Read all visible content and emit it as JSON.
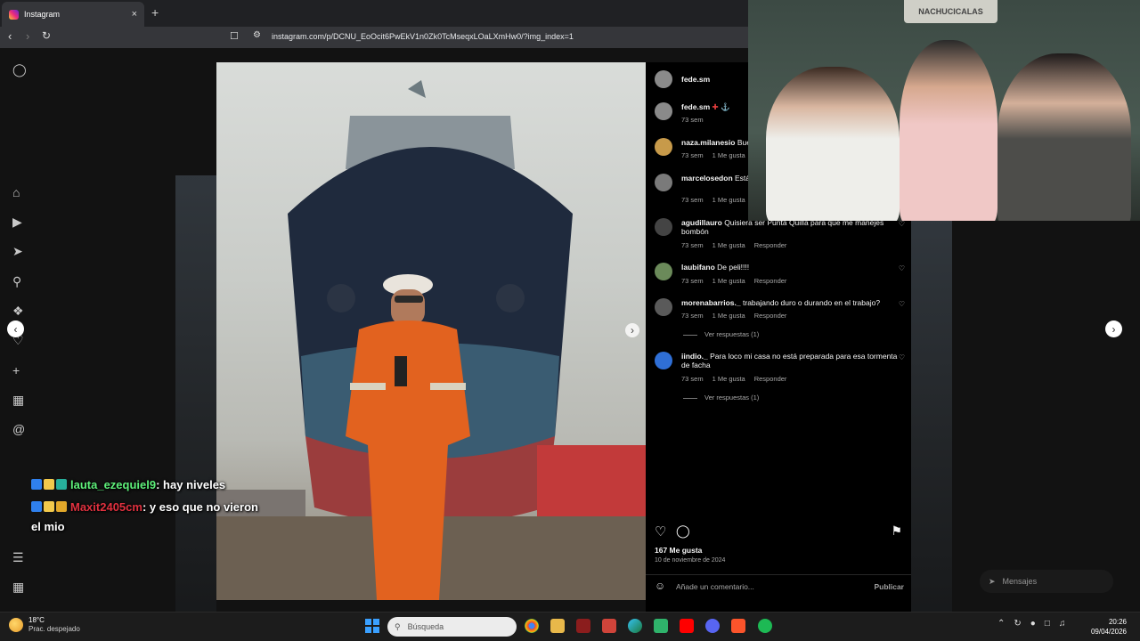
{
  "browser": {
    "tab_title": "Instagram",
    "tab_close": "×",
    "new_tab": "+",
    "url": "instagram.com/p/DCNU_EoOcit6PwEkV1n0Zk0TcMseqxLOaLXmHw0/?img_index=1"
  },
  "post": {
    "header_username": "fede.sm",
    "caption_username": "fede.sm",
    "caption_time": "73 sem",
    "likes": "167 Me gusta",
    "date": "10 de noviembre de 2024",
    "comment_placeholder": "Añade un comentario...",
    "publish_label": "Publicar"
  },
  "comments": [
    {
      "user": "naza.milanesio",
      "text": "Bue",
      "time": "73 sem",
      "likes": "1 Me gusta",
      "reply": ""
    },
    {
      "user": "marcelosedon",
      "text": "Estás barco \"",
      "time": "73 sem",
      "likes": "1 Me gusta",
      "reply": ""
    },
    {
      "user": "agudillauro",
      "text": "Quisiera ser Punta Quilla para que me manejes bombón",
      "time": "73 sem",
      "likes": "1 Me gusta",
      "reply": "Responder"
    },
    {
      "user": "laubifano",
      "text": "De peli!!!!",
      "time": "73 sem",
      "likes": "1 Me gusta",
      "reply": "Responder"
    },
    {
      "user": "morenabarrios._",
      "text": "trabajando duro o durando en el trabajo?",
      "time": "73 sem",
      "likes": "1 Me gusta",
      "reply": "Responder"
    },
    {
      "user": "iindio._",
      "text": "Para loco mi casa no está preparada para esa tormenta de facha",
      "time": "73 sem",
      "likes": "1 Me gusta",
      "reply": "Responder"
    }
  ],
  "view_replies": [
    "Ver respuestas (1)",
    "Ver respuestas (1)"
  ],
  "webcam_sign": "NACHUCICALAS",
  "chat": [
    {
      "user": "lauta_ezequiel9",
      "user_color": "#5ef07a",
      "message": ": hay niveles"
    },
    {
      "user": "Maxit2405cm",
      "user_color": "#e0313f",
      "message": ": y eso que no vieron",
      "message2": "el mio"
    }
  ],
  "messages_pill": "Mensajes",
  "taskbar": {
    "temp": "18°C",
    "weather": "Prac. despejado",
    "search_placeholder": "Búsqueda",
    "time": "20:26",
    "date": "09/04/2026"
  },
  "colors": {
    "accent": "#0095f6",
    "chat_green": "#5ef07a",
    "chat_red": "#e0313f"
  }
}
